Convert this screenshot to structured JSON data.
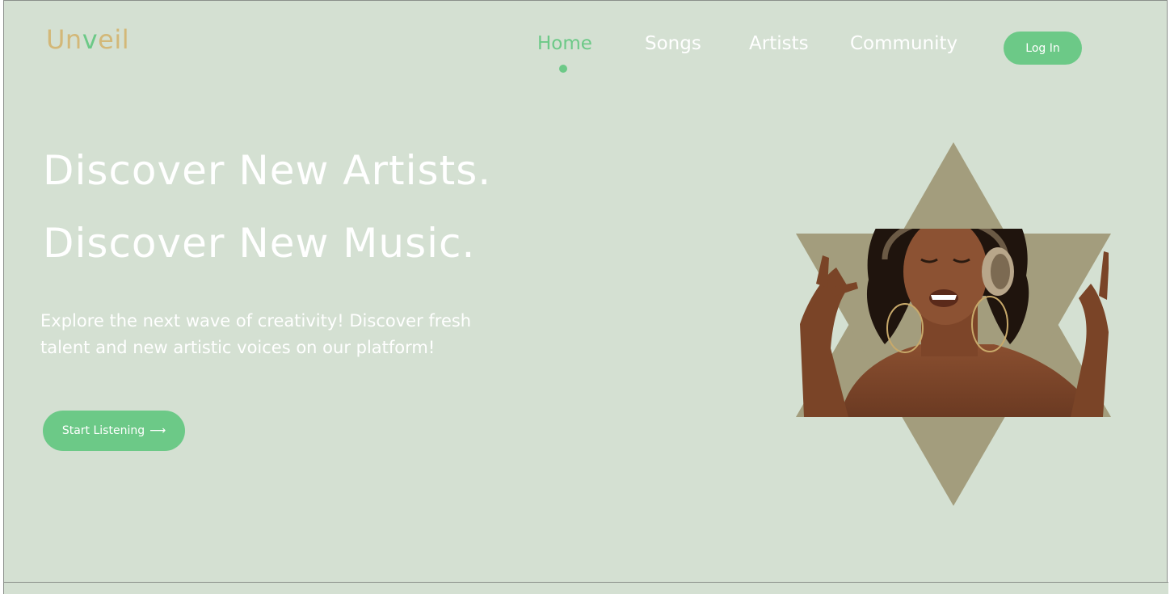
{
  "brand": {
    "name_part1": "Un",
    "name_part2": "v",
    "name_part3": "eil",
    "colors": {
      "background": "#d4e0d2",
      "accent_green": "#6cc987",
      "logo_gold": "#d3b878",
      "triangle": "#a39d7d"
    }
  },
  "nav": {
    "items": [
      {
        "label": "Home",
        "active": true
      },
      {
        "label": "Songs",
        "active": false
      },
      {
        "label": "Artists",
        "active": false
      },
      {
        "label": "Community",
        "active": false
      }
    ],
    "login_label": "Log In"
  },
  "hero": {
    "headline_1": "Discover New Artists.",
    "headline_2": "Discover New Music.",
    "subtext": "Explore the next wave of creativity! Discover fresh talent and new artistic voices on our platform!",
    "cta_label": "Start Listening",
    "cta_icon": "long-arrow-right-icon",
    "cta_arrow": "⟶",
    "image_icon": "woman-with-headphones-photo"
  }
}
